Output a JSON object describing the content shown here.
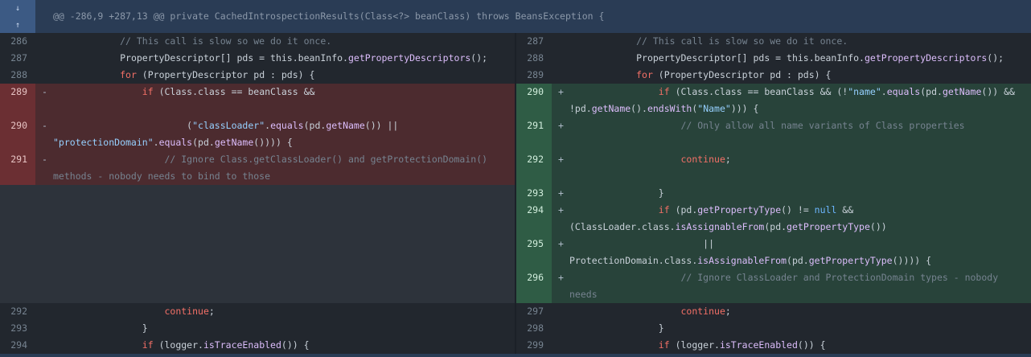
{
  "hunk": {
    "header": "@@ -286,9 +287,13 @@ private CachedIntrospectionResults(Class<?> beanClass) throws BeansException {"
  },
  "left": [
    {
      "num": "286",
      "type": "ctx",
      "sign": "",
      "code": "            // This call is slow so we do it once."
    },
    {
      "num": "287",
      "type": "ctx",
      "sign": "",
      "code": "            PropertyDescriptor[] pds = this.beanInfo.getPropertyDescriptors();"
    },
    {
      "num": "288",
      "type": "ctx",
      "sign": "",
      "code": "            for (PropertyDescriptor pd : pds) {"
    },
    {
      "num": "289",
      "type": "del",
      "sign": "-",
      "code": "                if (Class.class == beanClass &&"
    },
    {
      "num": "290",
      "type": "del",
      "sign": "-",
      "code": "                        (\"classLoader\".equals(pd.getName()) ||\n\"protectionDomain\".equals(pd.getName()))) {"
    },
    {
      "num": "291",
      "type": "del",
      "sign": "-",
      "code": "                    // Ignore Class.getClassLoader() and getProtectionDomain()\nmethods - nobody needs to bind to those"
    },
    {
      "num": "292",
      "type": "ctx",
      "sign": "",
      "code": "                    continue;"
    },
    {
      "num": "293",
      "type": "ctx",
      "sign": "",
      "code": "                }"
    },
    {
      "num": "294",
      "type": "ctx",
      "sign": "",
      "code": "                if (logger.isTraceEnabled()) {"
    }
  ],
  "right": [
    {
      "num": "287",
      "type": "ctx",
      "sign": "",
      "code": "            // This call is slow so we do it once."
    },
    {
      "num": "288",
      "type": "ctx",
      "sign": "",
      "code": "            PropertyDescriptor[] pds = this.beanInfo.getPropertyDescriptors();"
    },
    {
      "num": "289",
      "type": "ctx",
      "sign": "",
      "code": "            for (PropertyDescriptor pd : pds) {"
    },
    {
      "num": "290",
      "type": "add",
      "sign": "+",
      "code": "                if (Class.class == beanClass && (!\"name\".equals(pd.getName()) &&\n!pd.getName().endsWith(\"Name\"))) {"
    },
    {
      "num": "291",
      "type": "add",
      "sign": "+",
      "code": "                    // Only allow all name variants of Class properties"
    },
    {
      "num": "292",
      "type": "add",
      "sign": "+",
      "code": "                    continue;"
    },
    {
      "num": "293",
      "type": "add",
      "sign": "+",
      "code": "                }"
    },
    {
      "num": "294",
      "type": "add",
      "sign": "+",
      "code": "                if (pd.getPropertyType() != null &&\n(ClassLoader.class.isAssignableFrom(pd.getPropertyType())"
    },
    {
      "num": "295",
      "type": "add",
      "sign": "+",
      "code": "                        ||\nProtectionDomain.class.isAssignableFrom(pd.getPropertyType()))) {"
    },
    {
      "num": "296",
      "type": "add",
      "sign": "+",
      "code": "                    // Ignore ClassLoader and ProtectionDomain types - nobody needs\nto bind to those"
    },
    {
      "num": "297",
      "type": "ctx",
      "sign": "",
      "code": "                    continue;"
    },
    {
      "num": "298",
      "type": "ctx",
      "sign": "",
      "code": "                }"
    },
    {
      "num": "299",
      "type": "ctx",
      "sign": "",
      "code": "                if (logger.isTraceEnabled()) {"
    }
  ]
}
